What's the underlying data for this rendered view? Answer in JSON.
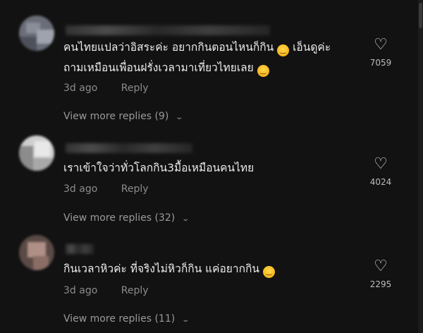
{
  "comments": [
    {
      "text_line1": "คนไทยแปลว่าอิสระค่ะ อยากกินตอนไหนก็กิน",
      "text_line2": "เอ็นดูค่ะ",
      "text_line3": "ถามเหมือนเพื่อนฝรั่งเวลามาเที่ยวไทยเลย",
      "emoji1": "😂",
      "emoji2": "😅",
      "time": "3d ago",
      "reply": "Reply",
      "more_replies": "View more replies (9)",
      "likes": "7059"
    },
    {
      "text_line1": "เราเข้าใจว่าทั่วโลกกิน3มื้อเหมือนคนไทย",
      "time": "3d ago",
      "reply": "Reply",
      "more_replies": "View more replies (32)",
      "likes": "4024"
    },
    {
      "text_line1": "กินเวลาหิวค่ะ ที่จริงไม่หิวก็กิน แค่อยากกิน",
      "emoji1": "😂",
      "time": "3d ago",
      "reply": "Reply",
      "more_replies": "View more replies (11)",
      "likes": "2295"
    }
  ],
  "icons": {
    "like": "heart-outline-icon",
    "expand": "chevron-down-icon"
  }
}
